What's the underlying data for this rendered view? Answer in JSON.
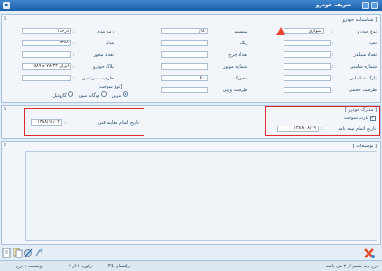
{
  "window": {
    "title": "تعریف خودرو"
  },
  "vehicle_info": {
    "section_title": "[ شناسنامه خودرو ]",
    "rows_right": [
      {
        "label": "نوع خودرو",
        "value": "سواری"
      },
      {
        "label": "تیپ",
        "value": ""
      },
      {
        "label": "تعداد سیلندر",
        "value": ""
      },
      {
        "label": "شماره شاسی",
        "value": ""
      },
      {
        "label": "بارک شناسایی",
        "value": ""
      },
      {
        "label": "ظرفیت حجمی",
        "value": ""
      }
    ],
    "rows_middle": [
      {
        "label": "سیستم",
        "value": "کاغ"
      },
      {
        "label": "رنگ",
        "value": ""
      },
      {
        "label": "تعداد چرخ",
        "value": ""
      },
      {
        "label": "شماره موتور",
        "value": ""
      },
      {
        "label": "محورک",
        "value": "٤٠"
      },
      {
        "label": "ظرفیت وزنی",
        "value": ""
      }
    ],
    "rows_left": [
      {
        "label": "رتبه بندی",
        "value": "درجه١"
      },
      {
        "label": "مدل",
        "value": "١٣٨٨"
      },
      {
        "label": "تعداد محور",
        "value": ""
      },
      {
        "label": "پلاک خودرو",
        "value": "ایران ٣٣-٧٨ ه ٥٨٩"
      },
      {
        "label": "ظرفیت سرنشین",
        "value": ""
      }
    ],
    "fuel_type_label": "[نوع سوخت]",
    "fuel_options": [
      "بنزین",
      "دوگانه سوز",
      "گازوئیل"
    ],
    "fuel_selected": 0
  },
  "documents": {
    "section_title": "[ مدارک خودرو ]",
    "fuel_card_label": "کارت سوخت",
    "fuel_card_checked": true,
    "insurance_label": "تاریخ اتمام بیمه نامه",
    "insurance_value": "١٣٨٨/٠٨/٠٩",
    "inspection_label": "تاریخ اتمام معاینه فنی",
    "inspection_value": "١٣٨٨/١١/٠٢"
  },
  "notes": {
    "section_title": "[ توضیحات ]"
  },
  "status_bar": {
    "help": "راهنمای F1",
    "record": "رکورد ٢ از ٢",
    "state": "وضعیت : درج",
    "message": "درج باید بشیم از ٢ می باشد"
  },
  "colors": {
    "accent": "#1c5fa8",
    "highlight": "#e0282d"
  },
  "icons": [
    "new-icon",
    "copy-icon",
    "edit-icon",
    "attach-icon",
    "delete-icon"
  ]
}
